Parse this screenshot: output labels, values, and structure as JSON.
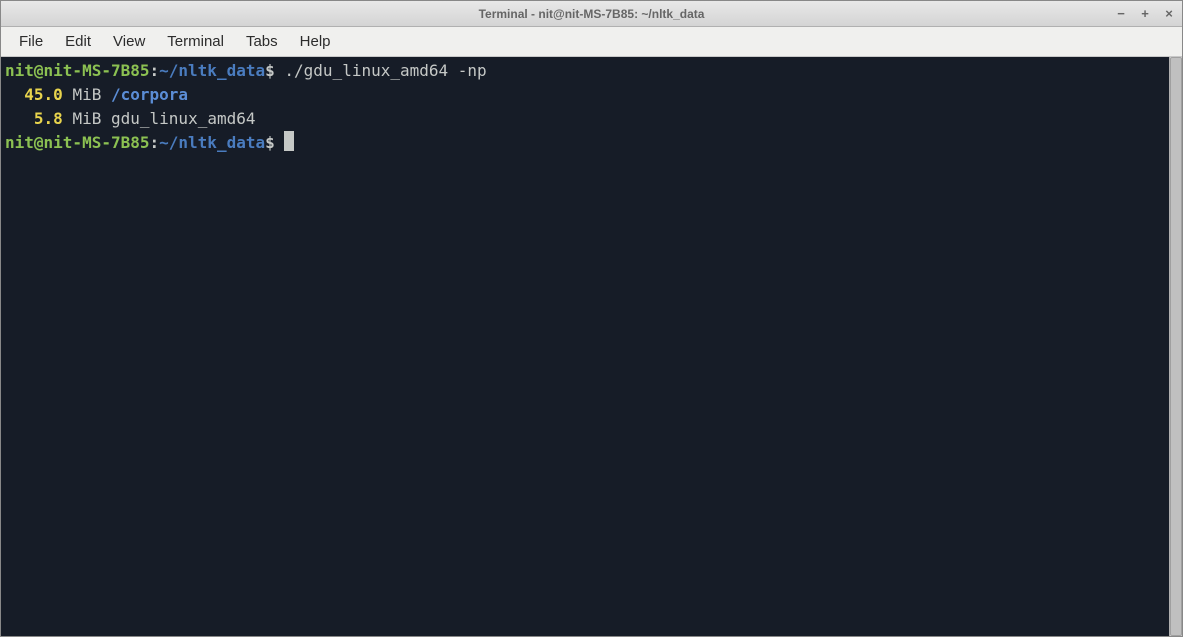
{
  "titlebar": {
    "title": "Terminal - nit@nit-MS-7B85: ~/nltk_data"
  },
  "menubar": {
    "items": [
      "File",
      "Edit",
      "View",
      "Terminal",
      "Tabs",
      "Help"
    ]
  },
  "terminal": {
    "prompt": {
      "user_host": "nit@nit-MS-7B85",
      "separator": ":",
      "path": "~/nltk_data",
      "symbol": "$"
    },
    "command": "./gdu_linux_amd64 -np",
    "output": [
      {
        "size": "45.0",
        "unit": "MiB",
        "name": "/corpora",
        "is_dir": true
      },
      {
        "size": "5.8",
        "unit": "MiB",
        "name": "gdu_linux_amd64",
        "is_dir": false
      }
    ]
  }
}
